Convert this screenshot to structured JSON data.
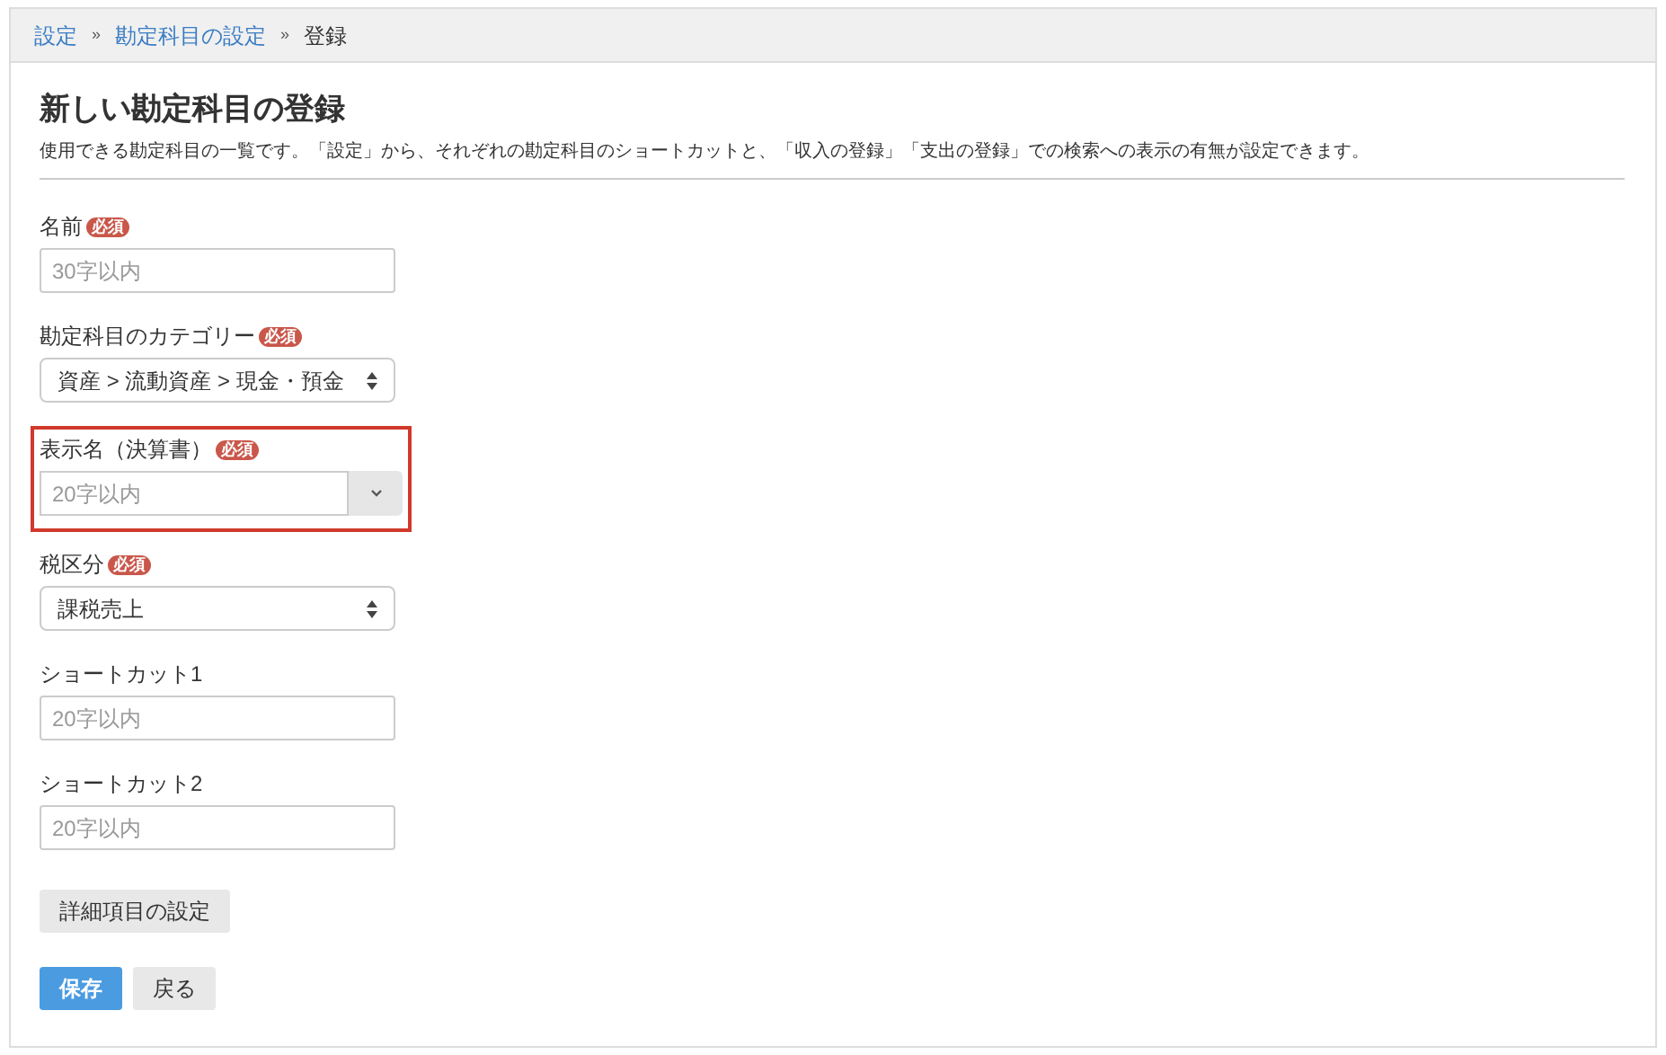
{
  "breadcrumb": [
    {
      "label": "設定",
      "link": true
    },
    {
      "label": "勘定科目の設定",
      "link": true
    },
    {
      "label": "登録",
      "link": false
    }
  ],
  "breadcrumb_separator": "»",
  "title": "新しい勘定科目の登録",
  "description": "使用できる勘定科目の一覧です。「設定」から、それぞれの勘定科目のショートカットと、「収入の登録」「支出の登録」での検索への表示の有無が設定できます。",
  "fields": [
    {
      "label": "名前",
      "badge": "必須",
      "kind": "text",
      "placeholder": "30字以内",
      "highlighted": false
    },
    {
      "label": "勘定科目のカテゴリー",
      "badge": "必須",
      "kind": "select",
      "value": "資産 > 流動資産 > 現金・預金",
      "highlighted": false
    },
    {
      "label": "表示名（決算書）",
      "badge": "必須",
      "kind": "combo",
      "placeholder": "20字以内",
      "highlighted": true
    },
    {
      "label": "税区分",
      "badge": "必須",
      "kind": "select",
      "value": "課税売上",
      "highlighted": false
    },
    {
      "label": "ショートカット1",
      "kind": "text",
      "placeholder": "20字以内",
      "highlighted": false
    },
    {
      "label": "ショートカット2",
      "kind": "text",
      "placeholder": "20字以内",
      "highlighted": false
    }
  ],
  "detail_button": "詳細項目の設定",
  "buttons": [
    {
      "label": "保存",
      "kind": "primary"
    },
    {
      "label": "戻る",
      "kind": "secondary"
    }
  ]
}
